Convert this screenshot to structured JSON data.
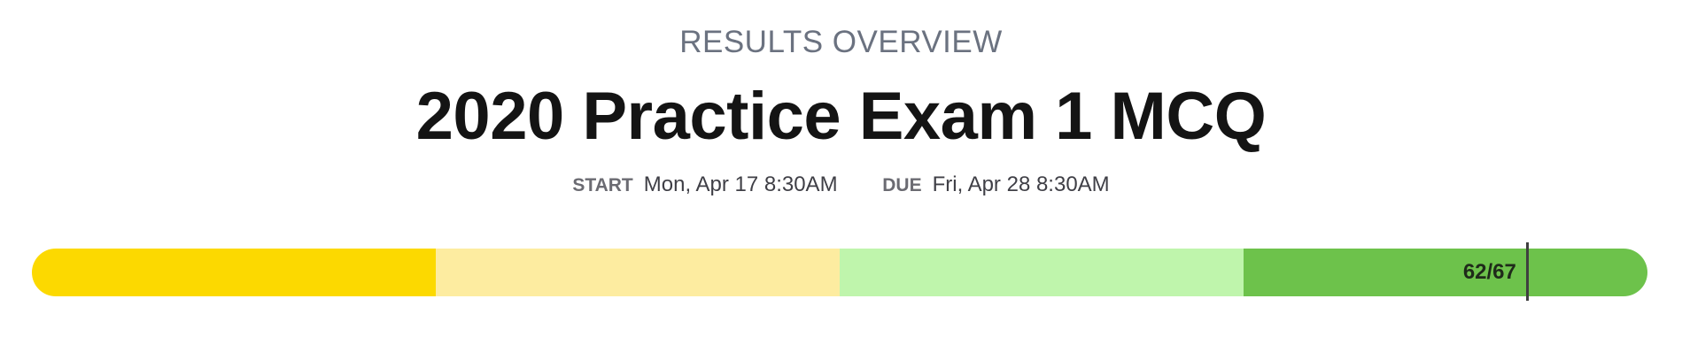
{
  "overview": {
    "label": "RESULTS OVERVIEW",
    "title": "2020 Practice Exam 1 MCQ"
  },
  "schedule": {
    "start_label": "START",
    "start_value": "Mon, Apr 17 8:30AM",
    "due_label": "DUE",
    "due_value": "Fri, Apr 28 8:30AM"
  },
  "score": {
    "text": "62/67",
    "earned": 62,
    "total": 67,
    "segment_colors": [
      "#fcd900",
      "#fdeca0",
      "#bff5ac",
      "#6dc24b"
    ]
  }
}
